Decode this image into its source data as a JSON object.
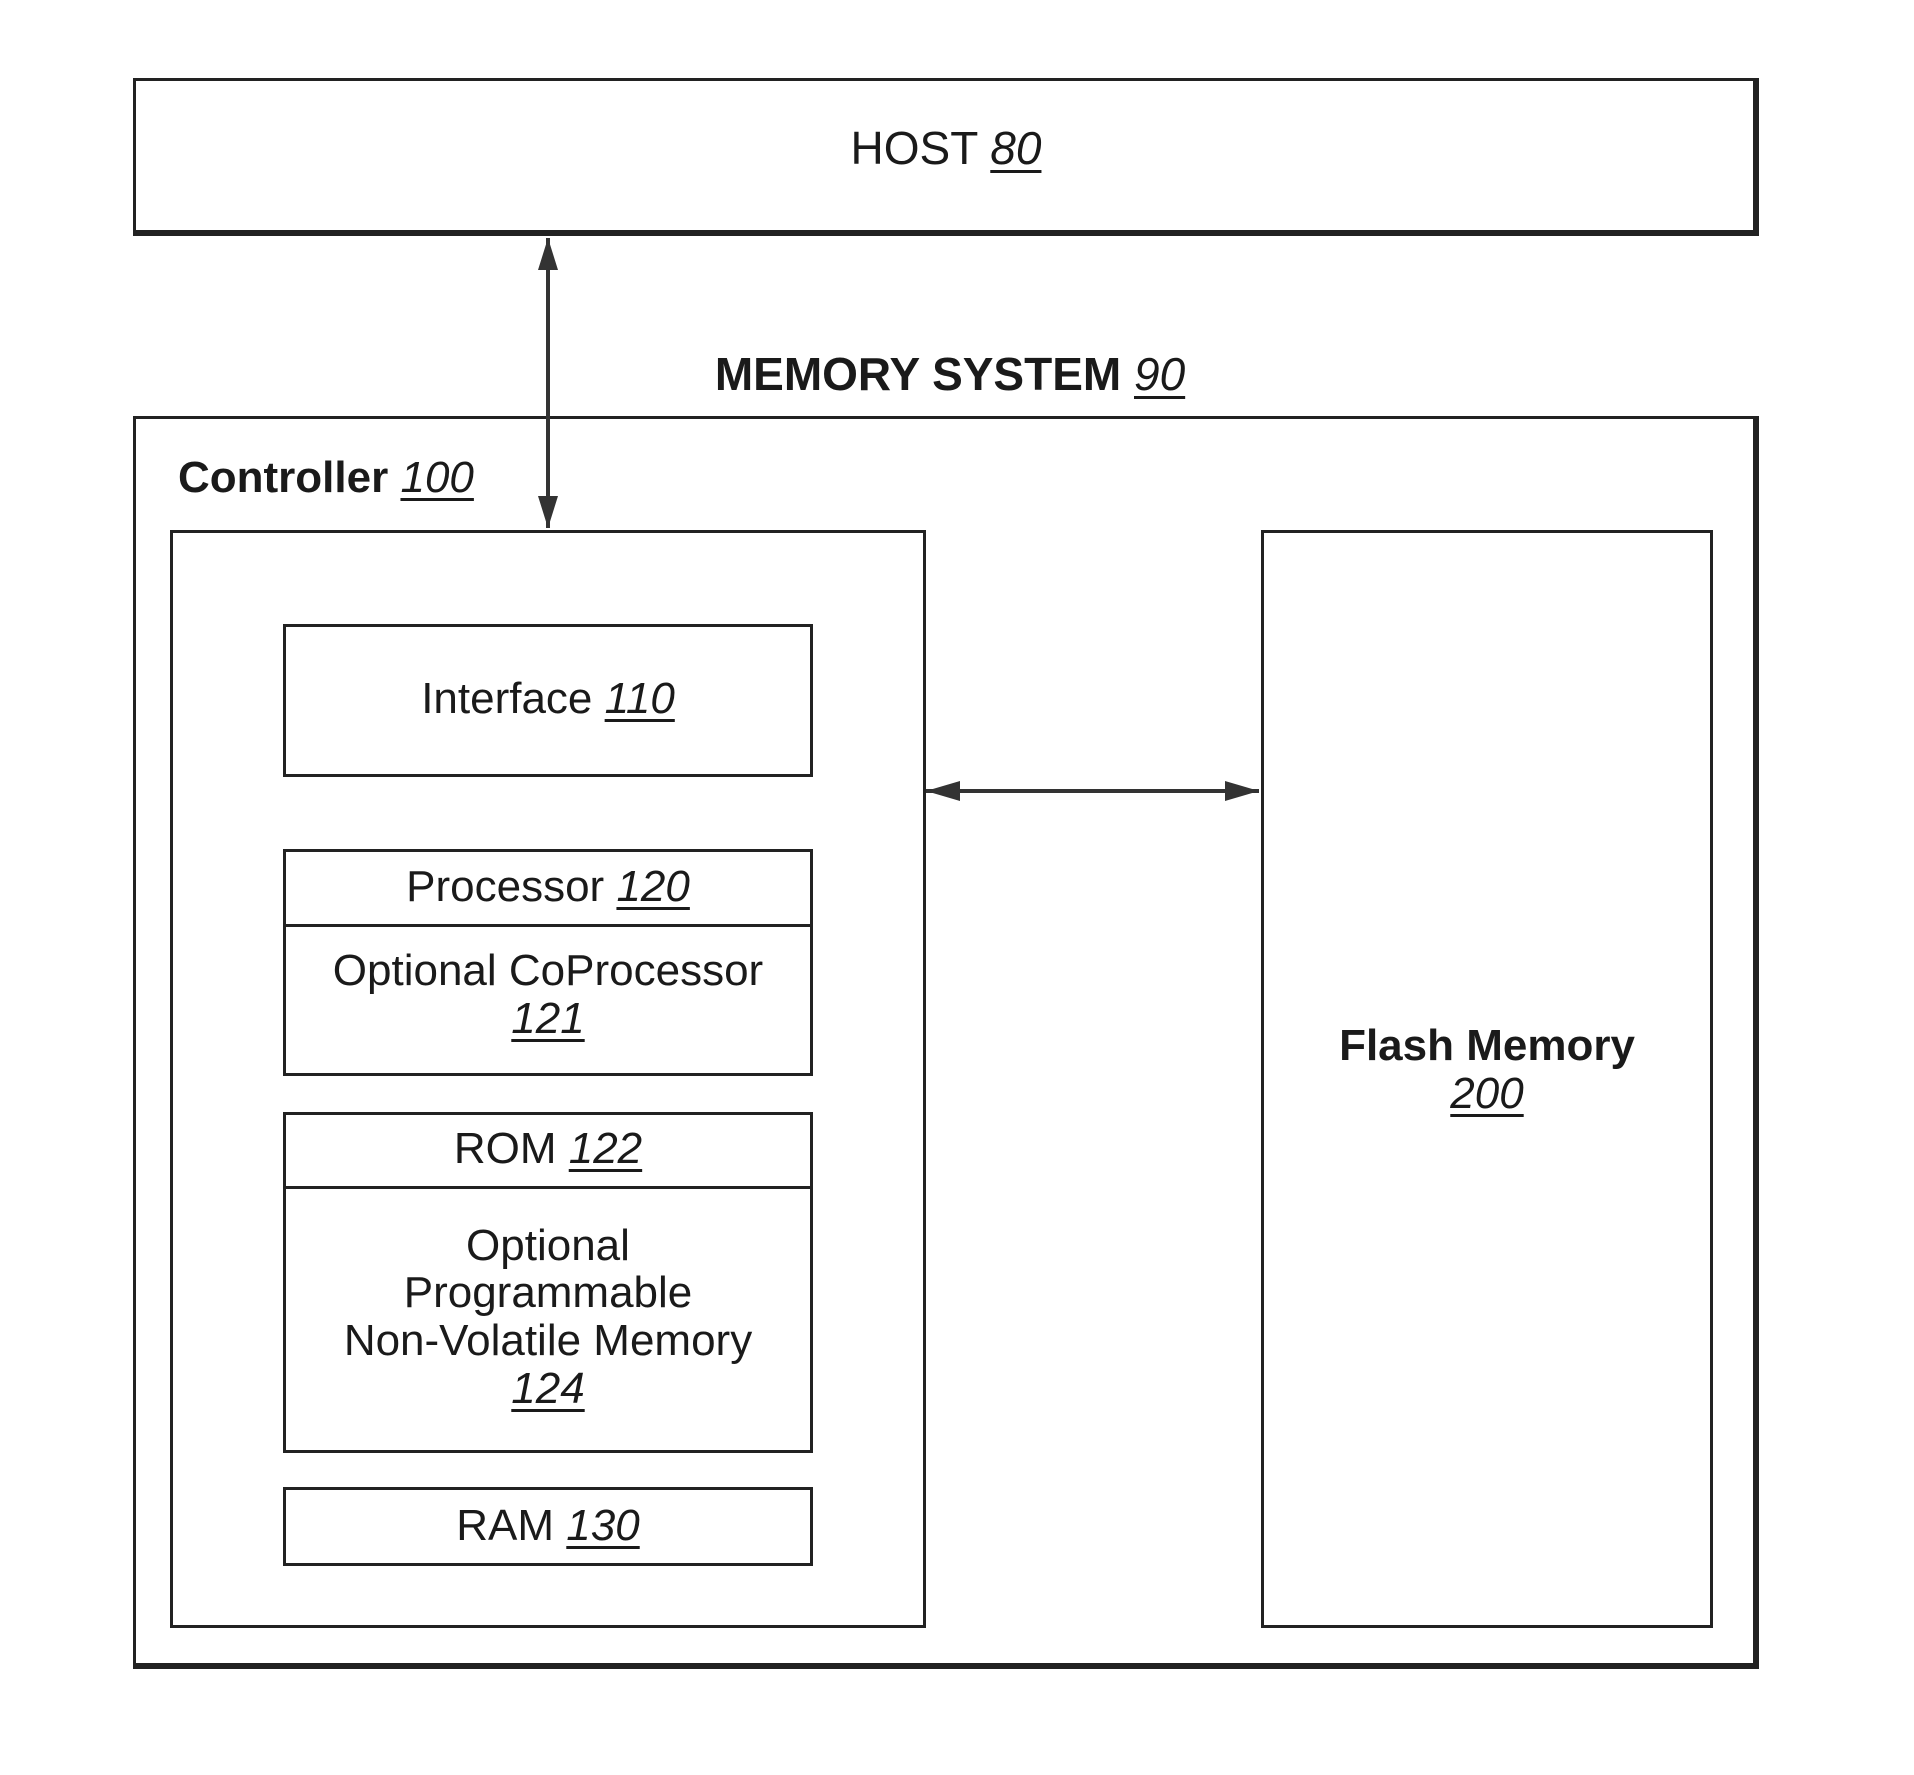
{
  "host": {
    "name": "HOST",
    "ref": "80"
  },
  "memory_system": {
    "name": "MEMORY SYSTEM",
    "ref": "90"
  },
  "controller": {
    "name": "Controller",
    "ref": "100",
    "components": {
      "interface": {
        "name": "Interface",
        "ref": "110"
      },
      "processor": {
        "name": "Processor",
        "ref": "120"
      },
      "coprocessor": {
        "name": "Optional CoProcessor",
        "ref": "121"
      },
      "rom": {
        "name": "ROM",
        "ref": "122"
      },
      "pnvm": {
        "lines": [
          "Optional",
          "Programmable",
          "Non-Volatile Memory"
        ],
        "ref": "124"
      },
      "ram": {
        "name": "RAM",
        "ref": "130"
      }
    }
  },
  "flash": {
    "name": "Flash Memory",
    "ref": "200"
  },
  "connections": [
    {
      "from": "HOST 80",
      "to": "Controller 100",
      "type": "bidirectional"
    },
    {
      "from": "Controller 100",
      "to": "Flash Memory 200",
      "type": "bidirectional"
    }
  ]
}
